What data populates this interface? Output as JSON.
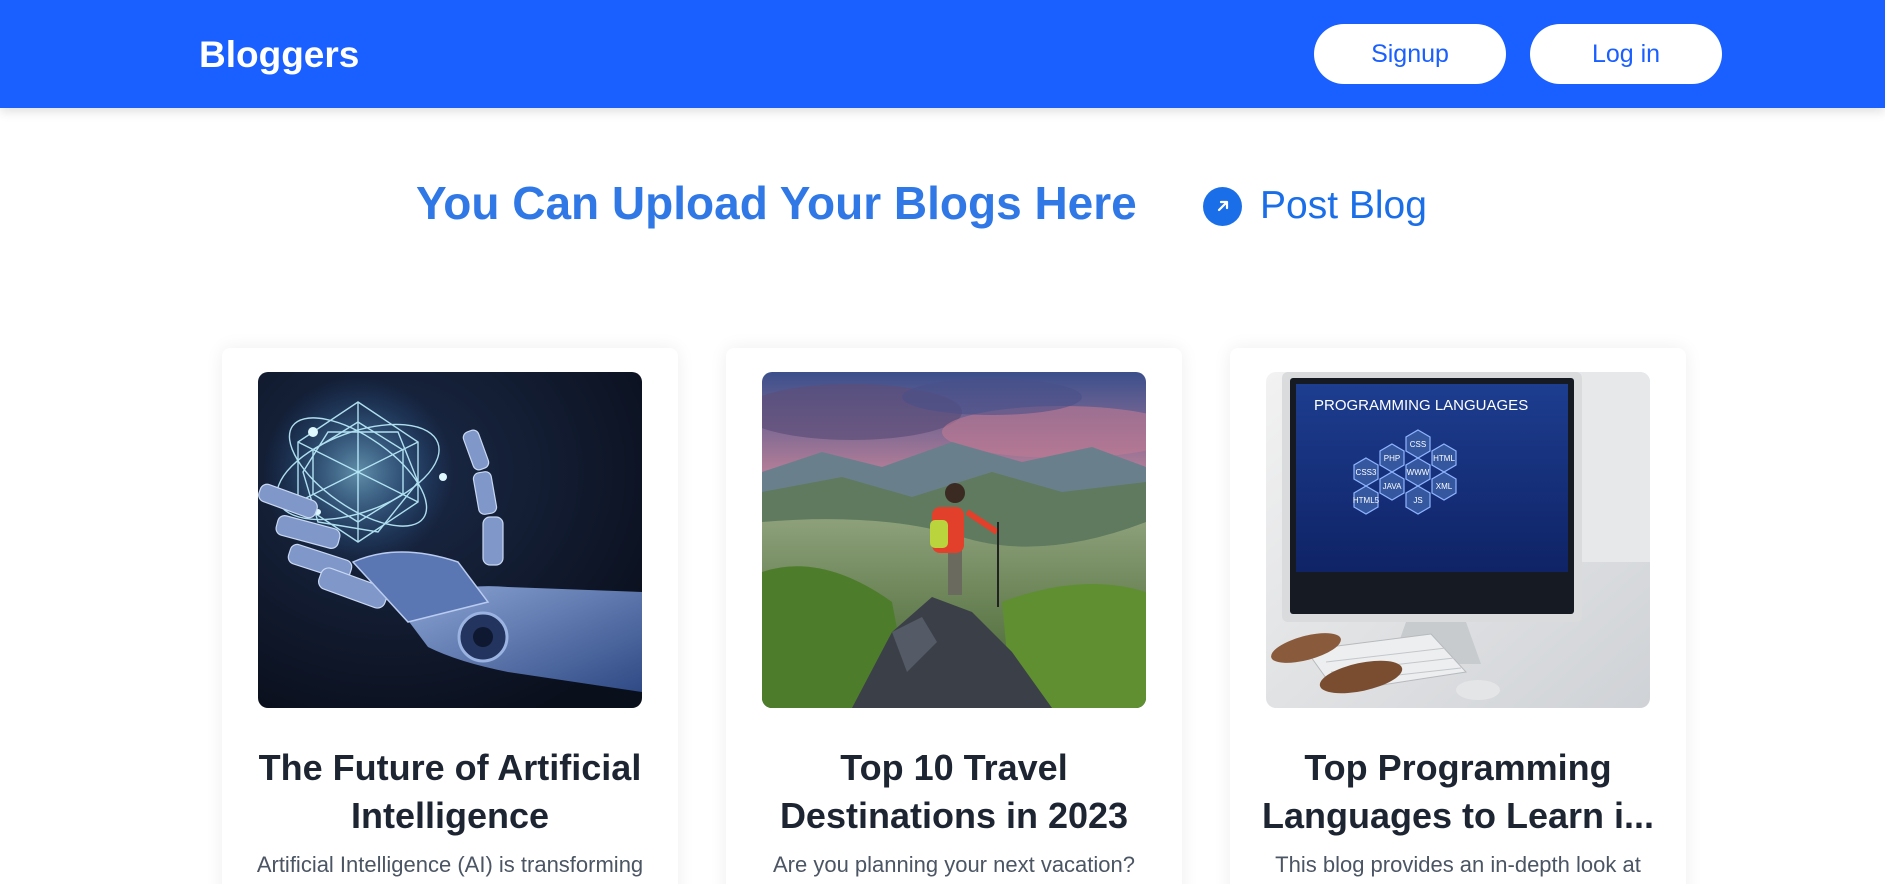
{
  "header": {
    "brand": "Bloggers",
    "signup_label": "Signup",
    "login_label": "Log in",
    "background_color": "#1a5fff"
  },
  "hero": {
    "title": "You Can Upload Your Blogs Here",
    "post_blog_label": "Post Blog",
    "post_blog_icon": "arrow-up-right-icon",
    "accent_color": "#2f78e6"
  },
  "cards": [
    {
      "title": "The Future of Artificial Intelligence",
      "excerpt": "Artificial Intelligence (AI) is transforming",
      "image": "robot-hand-holding-glowing-geometric-shape"
    },
    {
      "title": "Top 10 Travel Destinations in 2023",
      "excerpt": "Are you planning your next vacation?",
      "image": "hiker-on-mountain-summit-at-sunset"
    },
    {
      "title": "Top Programming Languages to Learn i...",
      "excerpt": "This blog provides an in-depth look at",
      "image": "computer-monitor-showing-programming-languages",
      "image_text": {
        "heading": "PROGRAMMING LANGUAGES",
        "hexes": [
          "CSS",
          "PHP",
          "HTML",
          "CSS3",
          "WWW",
          "JAVA",
          "XML",
          "HTML5",
          "JS"
        ]
      }
    }
  ]
}
